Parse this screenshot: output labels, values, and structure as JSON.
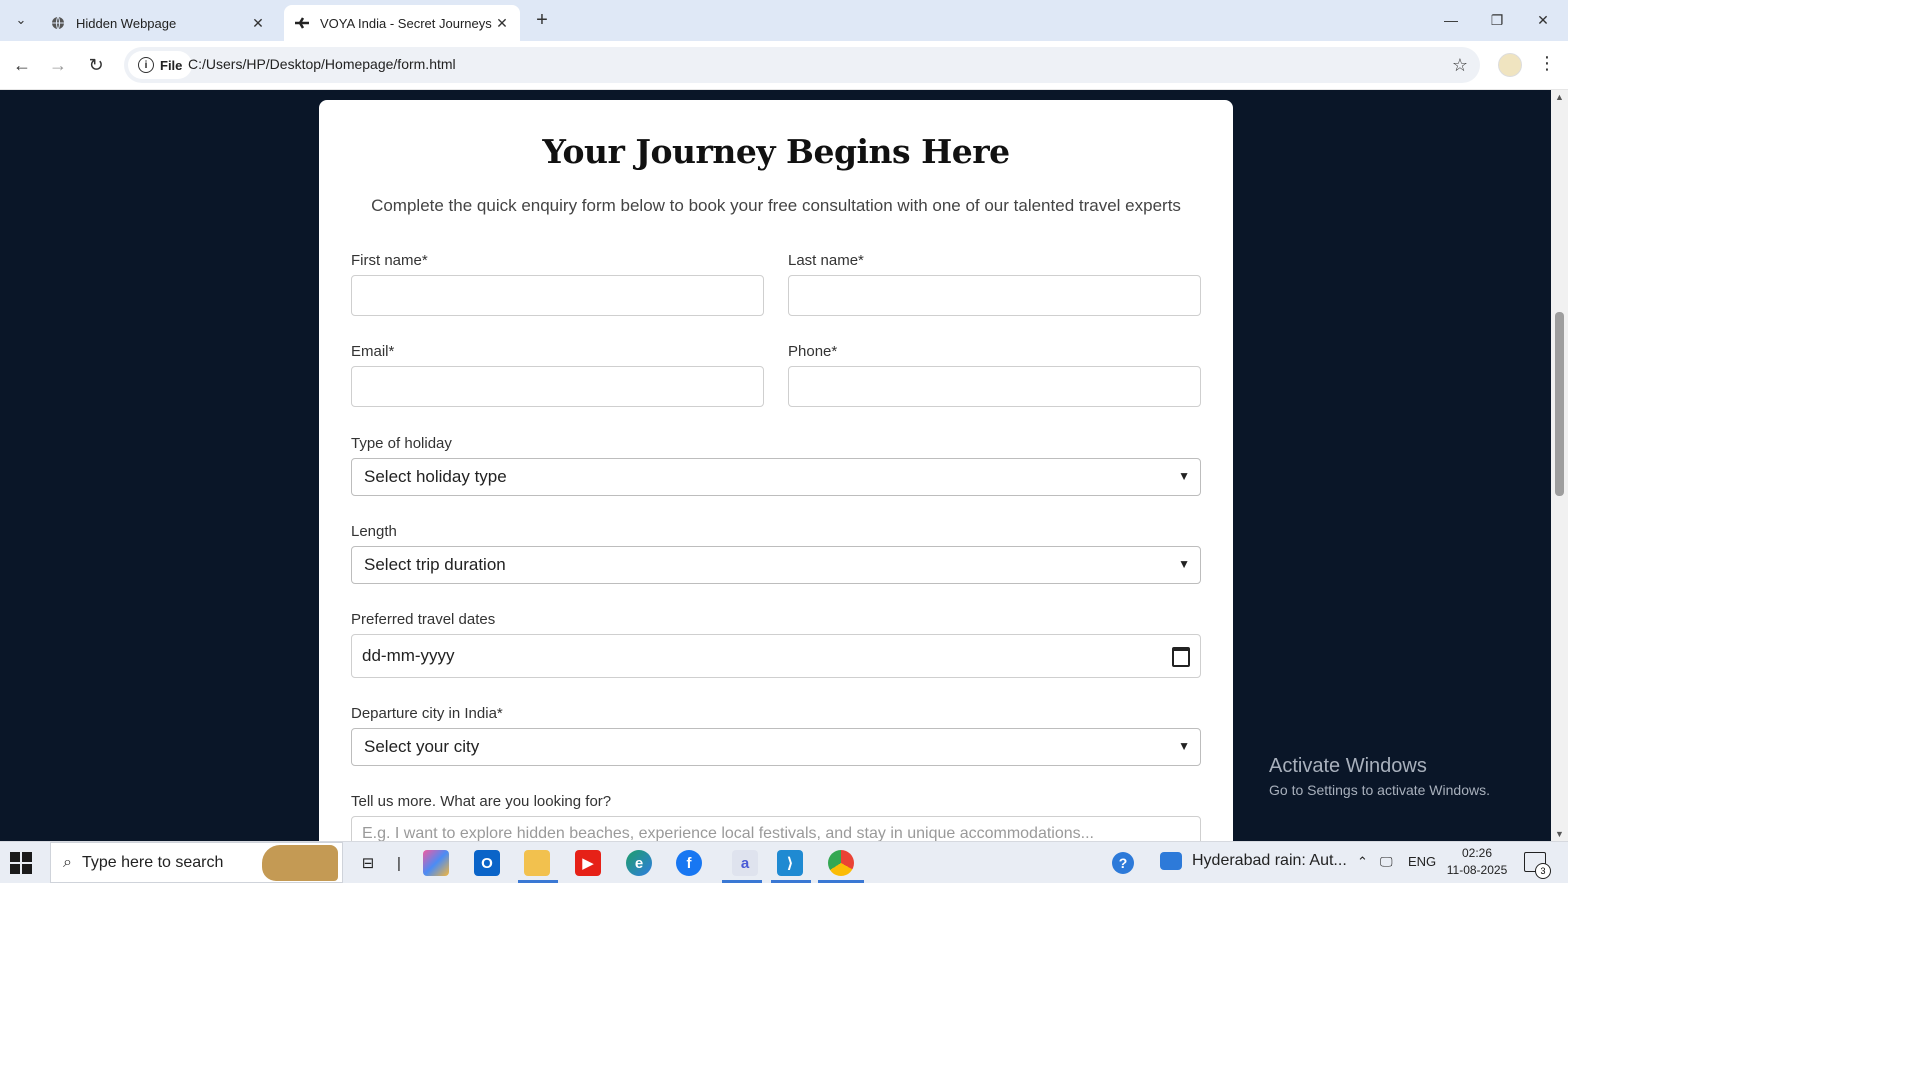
{
  "browser": {
    "tabs": [
      {
        "title": "Hidden Webpage",
        "active": false
      },
      {
        "title": "VOYA India - Secret Journeys",
        "active": true
      }
    ],
    "chip_label": "File",
    "url": "C:/Users/HP/Desktop/Homepage/form.html"
  },
  "form": {
    "heading": "Your Journey Begins Here",
    "subtitle": "Complete the quick enquiry form below to book your free consultation with one of our talented travel experts",
    "first_name_label": "First name*",
    "last_name_label": "Last name*",
    "email_label": "Email*",
    "phone_label": "Phone*",
    "holiday_label": "Type of holiday",
    "holiday_value": "Select holiday type",
    "length_label": "Length",
    "length_value": "Select trip duration",
    "dates_label": "Preferred travel dates",
    "dates_value": "dd-mm-yyyy",
    "city_label": "Departure city in India*",
    "city_value": "Select your city",
    "more_label": "Tell us more. What are you looking for?",
    "more_placeholder": "E.g. I want to explore hidden beaches, experience local festivals, and stay in unique accommodations..."
  },
  "watermark": {
    "line1": "Activate Windows",
    "line2": "Go to Settings to activate Windows."
  },
  "taskbar": {
    "search_placeholder": "Type here to search",
    "news": "Hyderabad rain: Aut...",
    "lang": "ENG",
    "time": "02:26",
    "date": "11-08-2025",
    "notifications": "3"
  }
}
